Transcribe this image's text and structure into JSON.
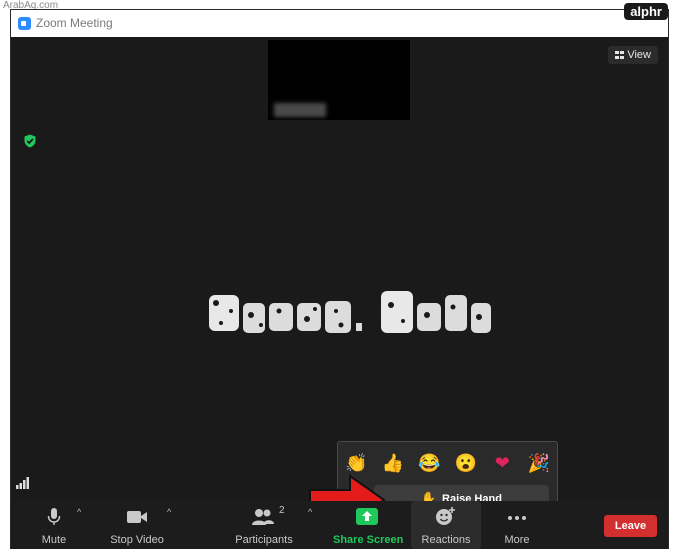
{
  "watermark": "ArabAq.com",
  "brand": "alphr",
  "window": {
    "title": "Zoom Meeting"
  },
  "stage": {
    "view_label": "View"
  },
  "reactions_popup": {
    "emojis": [
      {
        "name": "clap",
        "glyph": "👏"
      },
      {
        "name": "thumbs-up",
        "glyph": "👍"
      },
      {
        "name": "tears-of-joy",
        "glyph": "😂"
      },
      {
        "name": "surprised",
        "glyph": "😮"
      },
      {
        "name": "heart",
        "glyph": "❤"
      },
      {
        "name": "tada",
        "glyph": "🎉"
      }
    ],
    "raise_hand_label": "Raise Hand",
    "raise_hand_glyph": "✋"
  },
  "toolbar": {
    "mute_label": "Mute",
    "stop_video_label": "Stop Video",
    "participants_label": "Participants",
    "participants_count": "2",
    "share_screen_label": "Share Screen",
    "reactions_label": "Reactions",
    "more_label": "More",
    "leave_label": "Leave",
    "caret_glyph": "^"
  },
  "colors": {
    "share_green": "#1fc85a",
    "leave_red": "#d32f2f",
    "accent_blue": "#2d8cff",
    "arrow_red": "#e31b1b"
  },
  "icons": [
    "zoom-app-icon",
    "grid-icon",
    "shield-icon",
    "signal-icon",
    "microphone-icon",
    "video-camera-icon",
    "participants-icon",
    "share-screen-icon",
    "reactions-icon",
    "more-icon",
    "caret-icon",
    "raised-hand-icon",
    "red-arrow"
  ]
}
